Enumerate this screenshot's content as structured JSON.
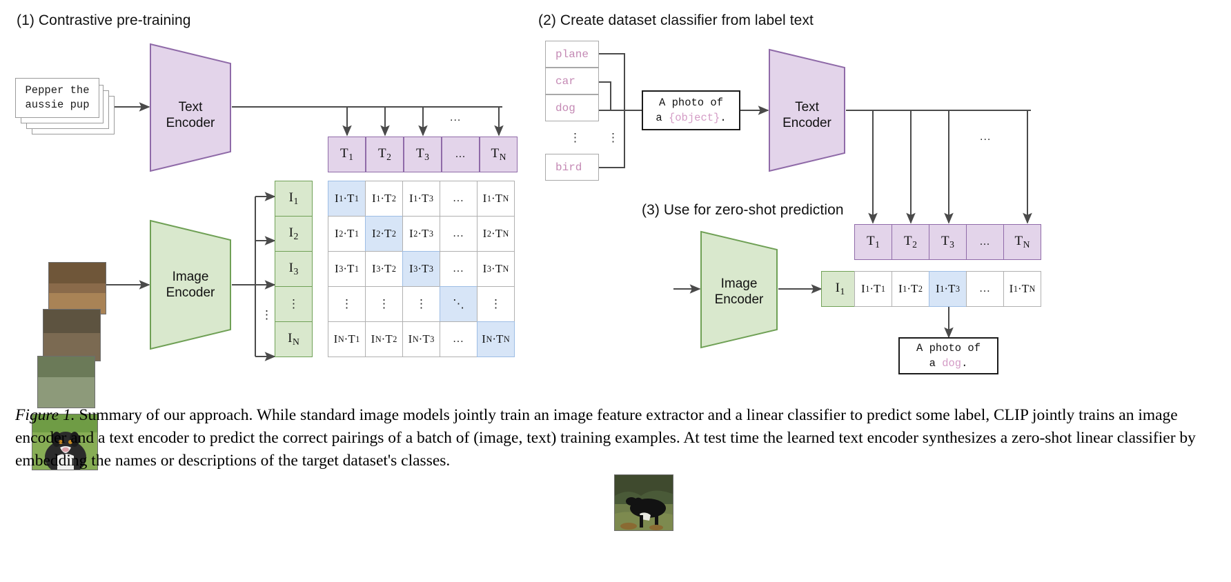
{
  "figure": {
    "panels": [
      {
        "id": "p1",
        "title": "(1) Contrastive pre-training"
      },
      {
        "id": "p2",
        "title": "(2) Create dataset classifier from label text"
      },
      {
        "id": "p3",
        "title": "(3) Use for zero-shot prediction"
      }
    ],
    "encoders": {
      "text_encoder_label_line1": "Text",
      "text_encoder_label_line2": "Encoder",
      "image_encoder_label_line1": "Image",
      "image_encoder_label_line2": "Encoder"
    },
    "panel1": {
      "input_text_line1": "Pepper the",
      "input_text_line2": "aussie pup",
      "text_features": [
        "T₁",
        "T₂",
        "T₃",
        "…",
        "Tₙ"
      ],
      "text_feature_labels": [
        {
          "base": "T",
          "sub": "1"
        },
        {
          "base": "T",
          "sub": "2"
        },
        {
          "base": "T",
          "sub": "3"
        },
        {
          "base": "...",
          "sub": ""
        },
        {
          "base": "T",
          "sub": "N"
        }
      ],
      "image_feature_labels": [
        {
          "base": "I",
          "sub": "1"
        },
        {
          "base": "I",
          "sub": "2"
        },
        {
          "base": "I",
          "sub": "3"
        },
        {
          "base": "⋮",
          "sub": ""
        },
        {
          "base": "I",
          "sub": "N"
        }
      ],
      "matrix_rows": [
        [
          "I₁·T₁",
          "I₁·T₂",
          "I₁·T₃",
          "…",
          "I₁·Tₙ"
        ],
        [
          "I₂·T₁",
          "I₂·T₂",
          "I₂·T₃",
          "…",
          "I₂·Tₙ"
        ],
        [
          "I₃·T₁",
          "I₃·T₂",
          "I₃·T₃",
          "…",
          "I₃·Tₙ"
        ],
        [
          "⋮",
          "⋮",
          "⋮",
          "⋱",
          "⋮"
        ],
        [
          "Iₙ·T₁",
          "Iₙ·T₂",
          "Iₙ·T₃",
          "…",
          "Iₙ·Tₙ"
        ]
      ],
      "diagonal_highlighted": [
        0,
        1,
        2,
        3,
        4
      ],
      "column_ellipsis": "...",
      "row_ellipsis": "⋮"
    },
    "panel2": {
      "class_labels": [
        "plane",
        "car",
        "dog",
        "bird"
      ],
      "class_ellipsis": "⋮",
      "prompt_template_line1": "A photo of",
      "prompt_template_line2_prefix": "a ",
      "prompt_template_token": "{object}",
      "prompt_template_line2_suffix": ".",
      "text_feature_labels": [
        {
          "base": "T",
          "sub": "1"
        },
        {
          "base": "T",
          "sub": "2"
        },
        {
          "base": "T",
          "sub": "3"
        },
        {
          "base": "...",
          "sub": ""
        },
        {
          "base": "T",
          "sub": "N"
        }
      ],
      "column_ellipsis": "..."
    },
    "panel3": {
      "image_feature_label": {
        "base": "I",
        "sub": "1"
      },
      "score_row": [
        "I₁·T₁",
        "I₁·T₂",
        "I₁·T₃",
        "…",
        "I₁·Tₙ"
      ],
      "score_row_labels": [
        {
          "i": "1",
          "t": "1"
        },
        {
          "i": "1",
          "t": "2"
        },
        {
          "i": "1",
          "t": "3"
        },
        {
          "i": "",
          "t": ""
        },
        {
          "i": "1",
          "t": "N"
        }
      ],
      "highlighted_index": 2,
      "prediction_line1": "A photo of",
      "prediction_line2_prefix": "a ",
      "prediction_token": "dog",
      "prediction_line2_suffix": "."
    },
    "caption": {
      "label": "Figure 1.",
      "text": " Summary of our approach. While standard image models jointly train an image feature extractor and a linear classifier to predict some label, CLIP jointly trains an image encoder and a text encoder to predict the correct pairings of a batch of (image, text) training examples. At test time the learned text encoder synthesizes a zero-shot linear classifier by embedding the names or descriptions of the target dataset's classes."
    },
    "colors": {
      "text_encoder_fill": "#e3d4ea",
      "text_encoder_stroke": "#8f6aa8",
      "image_encoder_fill": "#d9e8cd",
      "image_encoder_stroke": "#6fa055",
      "highlight_fill": "#d7e5f7",
      "highlight_stroke": "#9dbde4",
      "arrow": "#4a4a4a",
      "pink_token": "#d49cc6",
      "cell_border": "#b0b0b0"
    }
  }
}
